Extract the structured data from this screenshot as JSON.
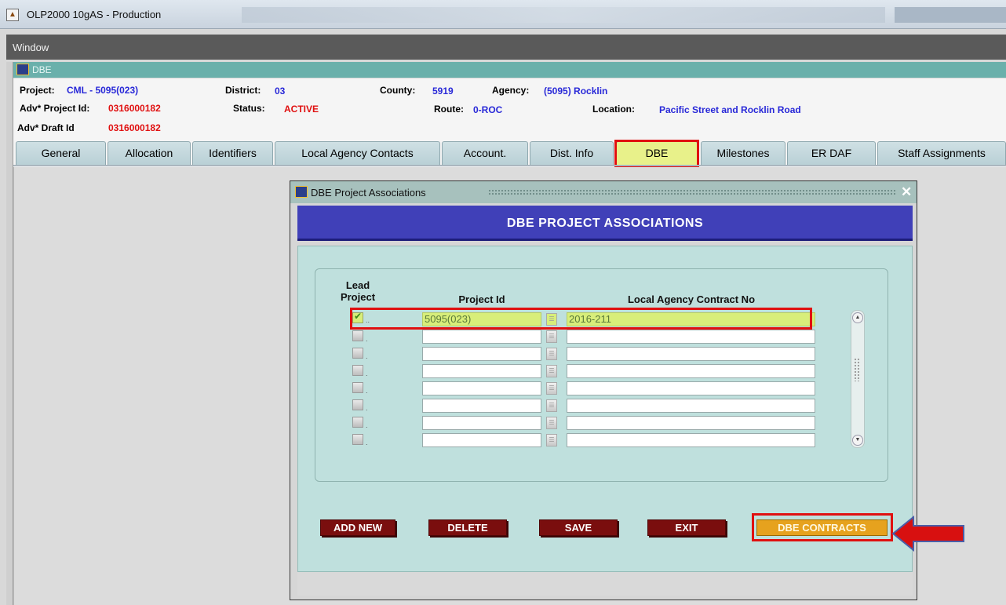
{
  "window": {
    "title": "OLP2000 10gAS - Production",
    "menu_window": "Window"
  },
  "form": {
    "title": "DBE"
  },
  "header": {
    "project_label": "Project:",
    "project_value": "CML - 5095(023)",
    "district_label": "District:",
    "district_value": "03",
    "county_label": "County:",
    "county_value": "5919",
    "agency_label": "Agency:",
    "agency_value": "(5095) Rocklin",
    "adv_project_label": "Adv* Project Id:",
    "adv_project_value": "0316000182",
    "status_label": "Status:",
    "status_value": "ACTIVE",
    "route_label": "Route:",
    "route_value": "0-ROC",
    "location_label": "Location:",
    "location_value": "Pacific Street and Rocklin Road",
    "adv_draft_label": "Adv* Draft Id",
    "adv_draft_value": "0316000182"
  },
  "tabs": [
    {
      "label": "General"
    },
    {
      "label": "Allocation"
    },
    {
      "label": "Identifiers"
    },
    {
      "label": "Local Agency Contacts"
    },
    {
      "label": "Account."
    },
    {
      "label": "Dist. Info"
    },
    {
      "label": "DBE"
    },
    {
      "label": "Milestones"
    },
    {
      "label": "ER DAF"
    },
    {
      "label": "Staff Assignments"
    }
  ],
  "active_tab": "DBE",
  "dialog": {
    "title": "DBE Project Associations",
    "heading": "DBE PROJECT ASSOCIATIONS",
    "col_lead_1": "Lead",
    "col_lead_2": "Project",
    "col_project_id": "Project Id",
    "col_contract": "Local Agency Contract No",
    "rows": [
      {
        "lead": true,
        "project_id": "5095(023)",
        "contract_no": "2016-211"
      },
      {
        "lead": false,
        "project_id": "",
        "contract_no": ""
      },
      {
        "lead": false,
        "project_id": "",
        "contract_no": ""
      },
      {
        "lead": false,
        "project_id": "",
        "contract_no": ""
      },
      {
        "lead": false,
        "project_id": "",
        "contract_no": ""
      },
      {
        "lead": false,
        "project_id": "",
        "contract_no": ""
      },
      {
        "lead": false,
        "project_id": "",
        "contract_no": ""
      },
      {
        "lead": false,
        "project_id": "",
        "contract_no": ""
      }
    ],
    "buttons": {
      "add_new": "ADD NEW",
      "delete": "DELETE",
      "save": "SAVE",
      "exit": "EXIT",
      "dbe_contracts": "DBE CONTRACTS"
    }
  },
  "colors": {
    "highlight": "#e01010",
    "banner": "#4040b8",
    "action_button": "#7a0e0e",
    "gold_button": "#e6a21e",
    "active_tab": "#e8f18a",
    "callout_arrow": "#d81010"
  }
}
